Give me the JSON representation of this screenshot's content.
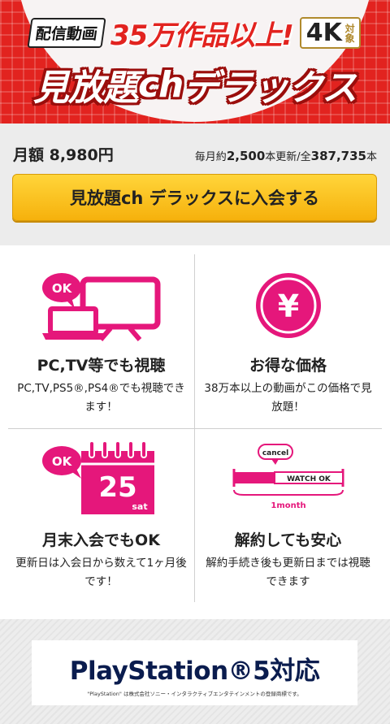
{
  "banner": {
    "tag_haishin": "配信動画",
    "headline_count": "35万作品以上!",
    "tag_4k": "4K",
    "tag_4k_sub": "対象",
    "title_main": "見放題",
    "title_ch": "ch",
    "title_deluxe": "デラックス"
  },
  "pricing": {
    "monthly_label": "月額 8,980円",
    "stats_prefix": "毎月約",
    "stats_monthly_count": "2,500",
    "stats_middle": "本更新/全",
    "stats_total_count": "387,735",
    "stats_suffix": "本",
    "join_button": "見放題ch デラックスに入会する"
  },
  "features": [
    {
      "title": "PC,TV等でも視聴",
      "desc": "PC,TV,PS5®,PS4®でも視聴できます！",
      "icon": "devices-icon",
      "icon_text": "OK"
    },
    {
      "title": "お得な価格",
      "desc": "38万本以上の動画がこの価格で見放題！",
      "icon": "yen-icon",
      "icon_text": "¥"
    },
    {
      "title": "月末入会でもOK",
      "desc": "更新日は入会日から数えて1ヶ月後です！",
      "icon": "calendar-icon",
      "icon_text": "OK",
      "calendar_day": "25",
      "calendar_weekday": "sat"
    },
    {
      "title": "解約しても安心",
      "desc": "解約手続き後も更新日までは視聴できます",
      "icon": "cancel-timeline-icon",
      "cancel_label": "cancel",
      "watch_label": "WATCH OK",
      "period_label": "1month"
    }
  ],
  "playstation": {
    "title": "PlayStation®5対応",
    "note": "\"PlayStation\" は株式会社ソニー・インタラクティブエンタテインメントの登録商標です。"
  },
  "colors": {
    "brand_red": "#e2231f",
    "accent_pink": "#e5177b",
    "button_yellow": "#f6b10c"
  }
}
